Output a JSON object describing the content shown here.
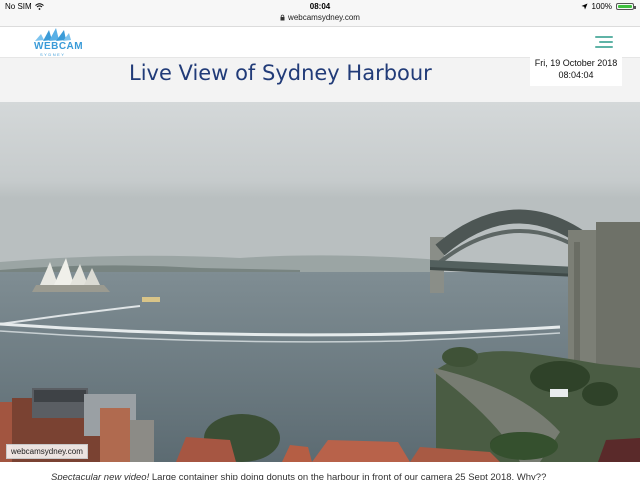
{
  "status_bar": {
    "carrier": "No SIM",
    "time": "08:04",
    "url": "webcamsydney.com",
    "battery": "100%",
    "battery_level": 1.0
  },
  "header": {
    "logo_text": "WEBCAM",
    "logo_subtext": "SYDNEY",
    "menu_icon": "hamburger-icon"
  },
  "page": {
    "title": "Live View of Sydney Harbour",
    "date": "Fri, 19 October 2018",
    "clock": "08:04:04"
  },
  "webcam": {
    "watermark": "webcamsydney.com"
  },
  "caption": {
    "emphasis": "Spectacular new video!",
    "text": " Large container ship doing donuts on the harbour in front of our camera 25 Sept 2018. Why??"
  },
  "colors": {
    "title": "#213b78",
    "logo": "#3a9bd8",
    "menu": "#5fb3a6",
    "battery": "#3fbf3f"
  }
}
